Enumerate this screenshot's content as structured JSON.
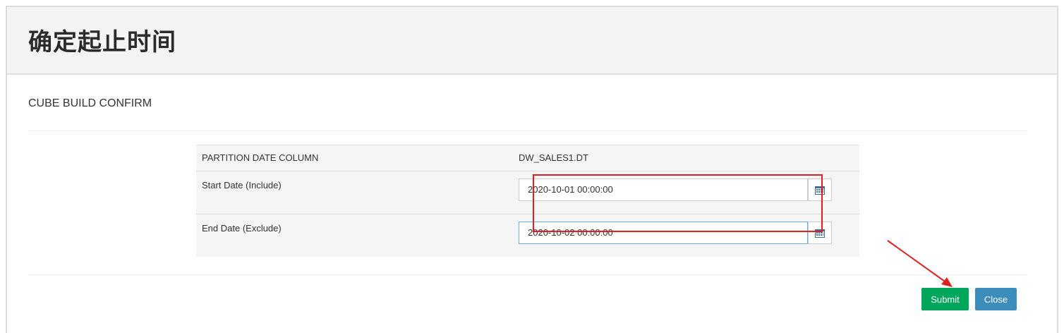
{
  "page": {
    "title": "确定起止时间"
  },
  "modal": {
    "title": "CUBE BUILD CONFIRM"
  },
  "table": {
    "rows": [
      {
        "label": "PARTITION DATE COLUMN",
        "value": "DW_SALES1.DT"
      },
      {
        "label": "Start Date (Include)",
        "value": "2020-10-01 00:00:00"
      },
      {
        "label": "End Date (Exclude)",
        "value": "2020-10-02 00:00:00"
      }
    ]
  },
  "buttons": {
    "submit": "Submit",
    "close": "Close"
  },
  "icons": {
    "calendar": "calendar-icon",
    "annotation_arrow": "red-arrow-pointer"
  },
  "colors": {
    "submit": "#00a65a",
    "close": "#3c8dbc",
    "annotation": "#e02020"
  }
}
